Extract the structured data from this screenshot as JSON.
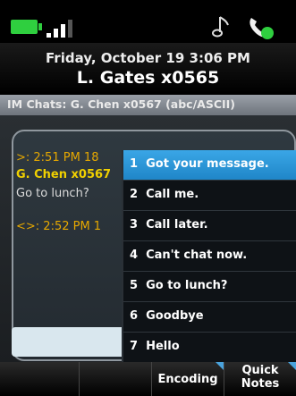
{
  "status": {
    "battery_icon": "battery-icon",
    "signal_icon": "signal-icon",
    "ringer_icon": "music-note-icon",
    "phone_icon": "phone-icon",
    "colors": {
      "battery": "#2fcf3f",
      "accent": "#1f86c8"
    }
  },
  "header": {
    "datetime": "Friday, October 19 3:06 PM",
    "user": "L. Gates x0565"
  },
  "im_bar": {
    "title": "IM Chats: G. Chen x0567 (abc/ASCII)"
  },
  "chat": {
    "time1": ">: 2:51 PM  18",
    "sender": "G. Chen x0567",
    "message": "Go to lunch?",
    "time2": "<>: 2:52 PM  1"
  },
  "quick_notes": {
    "items": [
      {
        "num": "1",
        "label": "Got your message."
      },
      {
        "num": "2",
        "label": "Call me."
      },
      {
        "num": "3",
        "label": "Call later."
      },
      {
        "num": "4",
        "label": "Can't chat now."
      },
      {
        "num": "5",
        "label": "Go to lunch?"
      },
      {
        "num": "6",
        "label": "Goodbye"
      },
      {
        "num": "7",
        "label": "Hello"
      }
    ],
    "selected_index": 0
  },
  "softkeys": {
    "encoding": "Encoding",
    "quick_line1": "Quick",
    "quick_line2": "Notes"
  }
}
